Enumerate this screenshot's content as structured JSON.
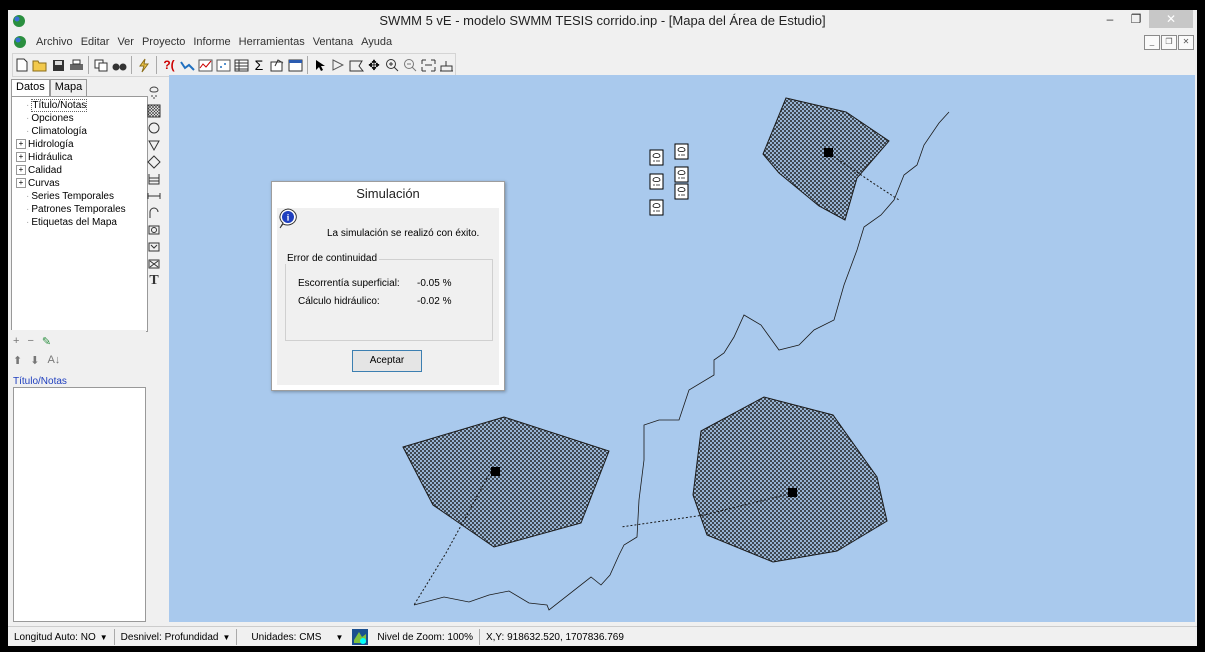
{
  "window": {
    "title": "SWMM 5 vE - modelo SWMM TESIS corrido.inp - [Mapa del Área de Estudio]",
    "minimize": "–",
    "restore": "❐",
    "close": "✕"
  },
  "menu": [
    "Archivo",
    "Editar",
    "Ver",
    "Proyecto",
    "Informe",
    "Herramientas",
    "Ventana",
    "Ayuda"
  ],
  "mdi_buttons": [
    "_",
    "❐",
    "✕"
  ],
  "toolbar_icons": [
    "new-icon",
    "open-icon",
    "save-icon",
    "print-icon",
    "copy-icon",
    "find-icon",
    "run-icon",
    "query-icon",
    "profile-plot-icon",
    "timeseries-plot-icon",
    "scatter-plot-icon",
    "table-icon",
    "statistics-icon",
    "options-icon",
    "window-icon",
    "select-icon",
    "select-vertex-icon",
    "select-region-icon",
    "pan-icon",
    "zoom-in-icon",
    "zoom-out-icon",
    "full-extent-icon",
    "measure-icon"
  ],
  "left_tabs": [
    "Datos",
    "Mapa"
  ],
  "tree": [
    {
      "label": "Título/Notas",
      "expandable": false,
      "selected": true
    },
    {
      "label": "Opciones",
      "expandable": false
    },
    {
      "label": "Climatología",
      "expandable": false
    },
    {
      "label": "Hidrología",
      "expandable": true
    },
    {
      "label": "Hidráulica",
      "expandable": true
    },
    {
      "label": "Calidad",
      "expandable": true
    },
    {
      "label": "Curvas",
      "expandable": true
    },
    {
      "label": "Series Temporales",
      "expandable": false
    },
    {
      "label": "Patrones Temporales",
      "expandable": false
    },
    {
      "label": "Etiquetas del Mapa",
      "expandable": false
    }
  ],
  "palette_icons": [
    "rain-gage-icon",
    "subcatchment-icon",
    "junction-icon",
    "outfall-icon",
    "divider-icon",
    "storage-icon",
    "conduit-icon",
    "pump-icon",
    "orifice-icon",
    "weir-icon",
    "outlet-icon",
    "label-icon"
  ],
  "props_toolbar": {
    "add": "+",
    "remove": "−",
    "edit": "✎",
    "up": "⬆",
    "down": "⬇",
    "sort": "A↓"
  },
  "selected_category": "Título/Notas",
  "dialog": {
    "title": "Simulación",
    "message": "La simulación se realizó con éxito.",
    "group_title": "Error de continuidad",
    "rows": [
      {
        "label": "Escorrentía superficial:",
        "value": "-0.05 %"
      },
      {
        "label": "Cálculo hidráulico:",
        "value": "-0.02 %"
      }
    ],
    "ok_label": "Aceptar"
  },
  "status": {
    "auto_length": "Longitud Auto: NO",
    "offsets": "Desnivel: Profundidad",
    "units": "Unidades: CMS",
    "zoom": "Nivel de Zoom: 100%",
    "xy": "X,Y: 918632.520, 1707836.769"
  },
  "colors": {
    "map_bg": "#a9c9ed",
    "accent": "#1f3fbf"
  }
}
